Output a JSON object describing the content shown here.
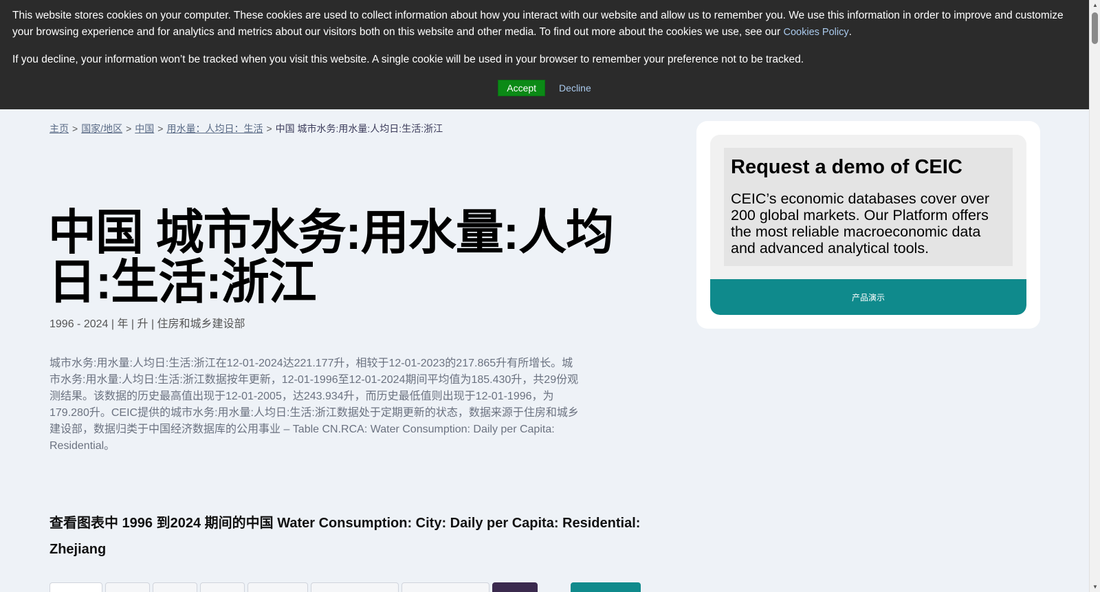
{
  "cookie_banner": {
    "text1": "This website stores cookies on your computer. These cookies are used to collect information about how you interact with our website and allow us to remember you. We use this information in order to improve and customize your browsing experience and for analytics and metrics about our visitors both on this website and other media. To find out more about the cookies we use, see our ",
    "policy_link": "Cookies Policy",
    "period": ".",
    "text2": "If you decline, your information won’t be tracked when you visit this website. A single cookie will be used in your browser to remember your preference not to be tracked.",
    "accept_label": "Accept",
    "decline_label": "Decline"
  },
  "breadcrumb": {
    "items": [
      "主页",
      "国家/地区",
      "中国",
      "用水量：人均日：生活"
    ],
    "separator": ">",
    "current": "中国 城市水务:用水量:人均日:生活:浙江"
  },
  "page": {
    "title": "中国 城市水务:用水量:人均日:生活:浙江",
    "meta": "1996 - 2024 | 年 | 升 | 住房和城乡建设部",
    "description": "城市水务:用水量:人均日:生活:浙江在12-01-2024达221.177升，相较于12-01-2023的217.865升有所增长。城市水务:用水量:人均日:生活:浙江数据按年更新，12-01-1996至12-01-2024期间平均值为185.430升，共29份观测结果。该数据的历史最高值出现于12-01-2005，达243.934升，而历史最低值则出现于12-01-1996，为179.280升。CEIC提供的城市水务:用水量:人均日:生活:浙江数据处于定期更新的状态，数据来源于住房和城乡建设部，数据归类于中国经济数据库的公用事业 – Table CN.RCA: Water Consumption: Daily per Capita: Residential。",
    "chart_heading": "查看图表中 1996 到2024 期间的中国 Water Consumption: City: Daily per Capita: Residential: Zhejiang"
  },
  "sidebar": {
    "demo_title": "Request a demo of CEIC",
    "demo_text": "CEIC’s economic databases cover over 200 global markets. Our Platform offers the most reliable macroeconomic data and advanced analytical tools.",
    "demo_button": "产品演示"
  },
  "colors": {
    "banner_bg": "#2b2b2b",
    "accept_green": "#0b8a16",
    "teal": "#0f8a8c",
    "page_bg": "#eef2f7"
  }
}
